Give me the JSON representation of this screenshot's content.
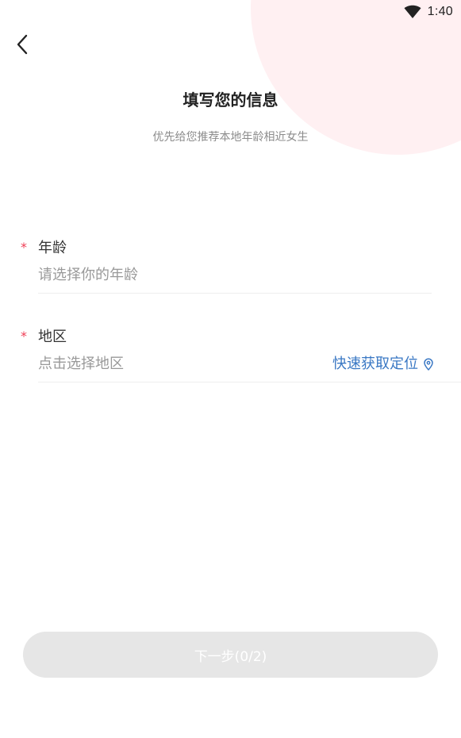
{
  "status_bar": {
    "time": "1:40",
    "wifi_icon": "wifi-icon"
  },
  "header": {
    "back_icon": "chevron-left-icon",
    "title": "填写您的信息",
    "subtitle": "优先给您推荐本地年龄相近女生"
  },
  "form": {
    "age": {
      "required_mark": "*",
      "label": "年龄",
      "placeholder": "请选择你的年龄"
    },
    "region": {
      "required_mark": "*",
      "label": "地区",
      "placeholder": "点击选择地区",
      "locate_label": "快速获取定位",
      "locate_icon": "location-pin-icon"
    }
  },
  "footer": {
    "next_label": "下一步(0/2)"
  },
  "colors": {
    "accent_blue": "#3a78c4",
    "required_red": "#ef3d55",
    "blob_pink": "#fff0f2",
    "button_disabled": "#e6e6e6"
  }
}
